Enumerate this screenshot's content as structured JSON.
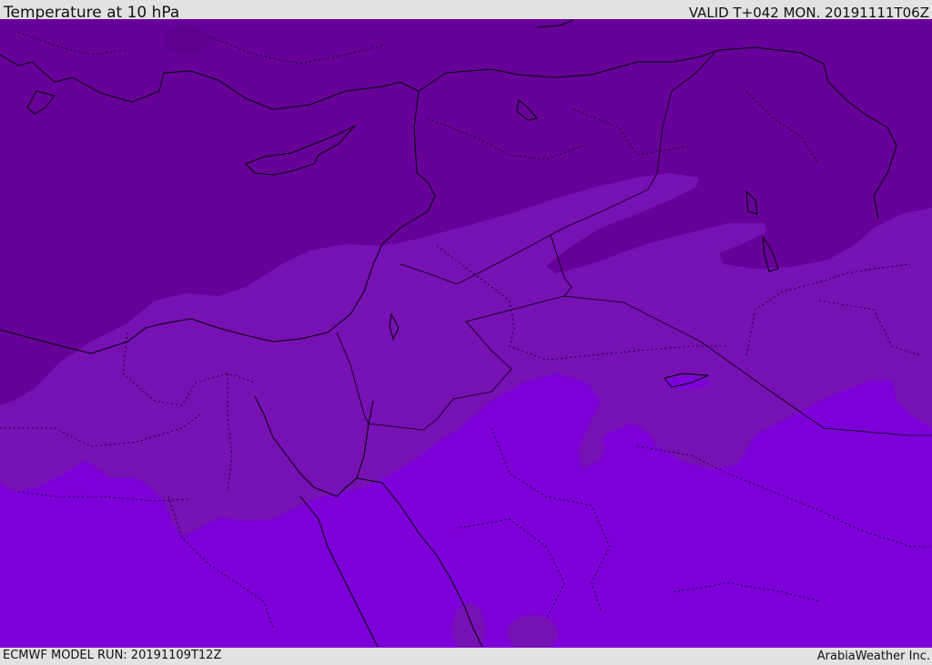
{
  "header": {
    "title": "Temperature at 10 hPa",
    "valid": "VALID T+042 MON. 20191111T06Z"
  },
  "footer": {
    "model_run": "ECMWF MODEL RUN: 20191109T12Z",
    "credit": "ArabiaWeather Inc."
  },
  "colors": {
    "darkest": "#670099",
    "dark_band": "#7611b4",
    "light_region": "#7d00d9",
    "coastline": "#000000"
  }
}
